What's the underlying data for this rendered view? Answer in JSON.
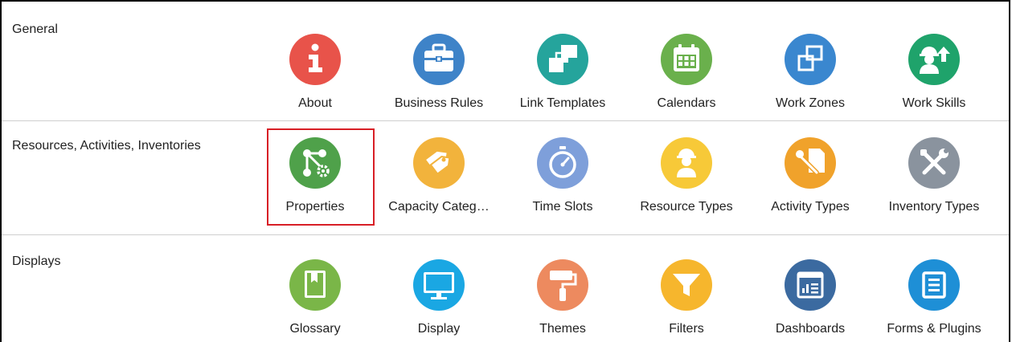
{
  "sections": [
    {
      "title": "General",
      "items": [
        {
          "label": "About",
          "icon": "info-icon",
          "color": "#e8534a"
        },
        {
          "label": "Business Rules",
          "icon": "briefcase-icon",
          "color": "#3e83c8"
        },
        {
          "label": "Link Templates",
          "icon": "link-templates-icon",
          "color": "#25a49c"
        },
        {
          "label": "Calendars",
          "icon": "calendar-icon",
          "color": "#6ab04c"
        },
        {
          "label": "Work Zones",
          "icon": "work-zones-icon",
          "color": "#3a87cf"
        },
        {
          "label": "Work Skills",
          "icon": "worker-upgrade-icon",
          "color": "#1fa36b"
        }
      ]
    },
    {
      "title": "Resources, Activities, Inventories",
      "items": [
        {
          "label": "Properties",
          "icon": "properties-nodes-icon",
          "color": "#4fa14a"
        },
        {
          "label": "Capacity Categ…",
          "icon": "tags-icon",
          "color": "#f2b33c"
        },
        {
          "label": "Time Slots",
          "icon": "stopwatch-icon",
          "color": "#7e9fda"
        },
        {
          "label": "Resource Types",
          "icon": "technician-icon",
          "color": "#f7c938"
        },
        {
          "label": "Activity Types",
          "icon": "tools-icon",
          "color": "#f0a22b"
        },
        {
          "label": "Inventory Types",
          "icon": "wrench-screwdriver-icon",
          "color": "#8a939e"
        }
      ]
    },
    {
      "title": "Displays",
      "items": [
        {
          "label": "Glossary",
          "icon": "book-icon",
          "color": "#7ab648"
        },
        {
          "label": "Display",
          "icon": "monitor-icon",
          "color": "#1aa7e3"
        },
        {
          "label": "Themes",
          "icon": "paint-roller-icon",
          "color": "#ed8a5f"
        },
        {
          "label": "Filters",
          "icon": "funnel-icon",
          "color": "#f6b62d"
        },
        {
          "label": "Dashboards",
          "icon": "dashboard-icon",
          "color": "#3b6aa0"
        },
        {
          "label": "Forms & Plugins",
          "icon": "form-icon",
          "color": "#1e8fd6"
        }
      ]
    }
  ],
  "highlighted_item": "Properties"
}
